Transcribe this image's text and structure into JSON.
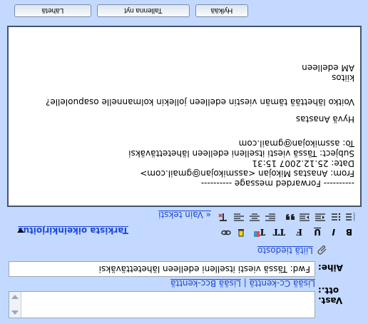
{
  "header": {
    "reply_to_label": "Vast. ott.:",
    "subject_label": "Aihe:",
    "subject_value": "Fwd: Tässä viesti itselleni edelleen lähetettäväksi",
    "add_cc_label": "Lisää Cc-kenttä",
    "separator": "|",
    "add_bcc_label": "Lisää Bcc-kenttä",
    "attach_label": "Liitä tiedosto"
  },
  "toolbar": {
    "spellcheck_label": "Tarkista oikeinkirjoitus",
    "plain_text_label": "« Vain teksti"
  },
  "body_lines": [
    "---------- Forwarded message ----------",
    "From: Anastas Mikojan <assmikojan@gmail.com>",
    "Date: 25.12.2007 15:31",
    "Subject: Tässä viesti itselleni edelleen lähetettäväksi",
    "To: assmikojan@gmail.com",
    "",
    "Hyvä Anastas",
    "",
    "Voitko lähettää tämän viestin edelleen jollekin kolmannelle osapuolelle?",
    "",
    "kiitos",
    "AM edelleen"
  ],
  "buttons": {
    "send": "Lähetä",
    "save": "Tallenna nyt",
    "discard": "Hylkää"
  },
  "colors": {
    "panel_bg": "#c3d9ff",
    "link": "#1f48d3",
    "border": "#44546a"
  }
}
